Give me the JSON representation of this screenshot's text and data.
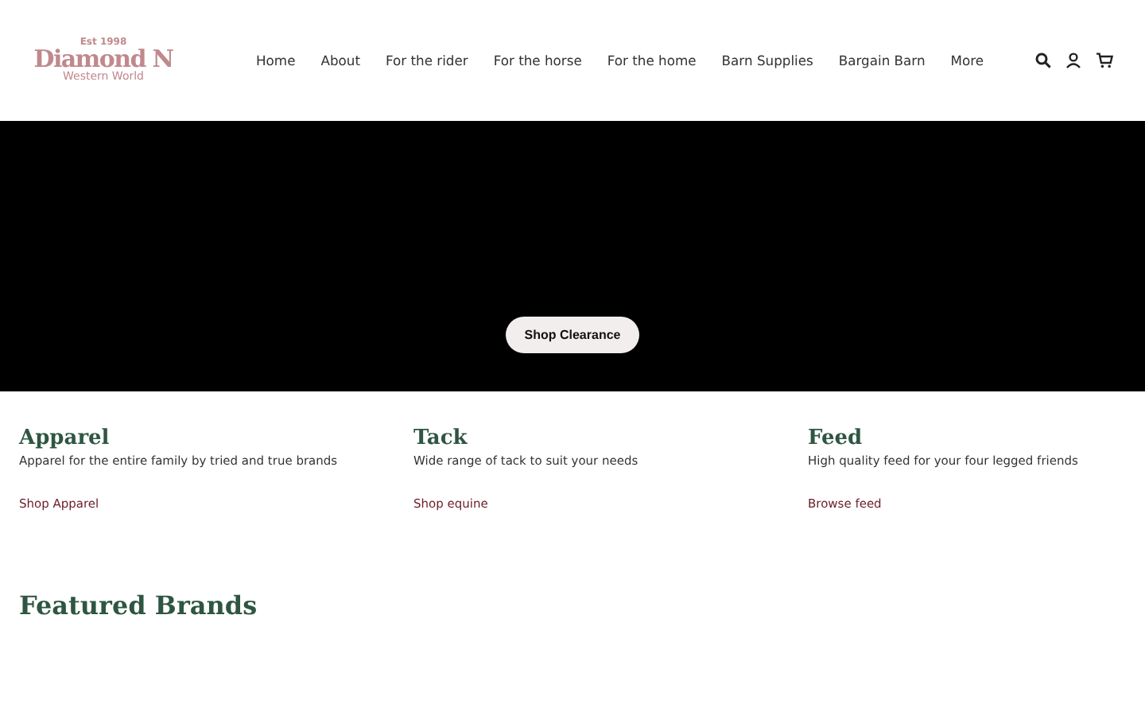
{
  "logo": {
    "est": "Est 1998",
    "name": "Diamond N",
    "sub": "Western World"
  },
  "nav": [
    {
      "label": "Home"
    },
    {
      "label": "About"
    },
    {
      "label": "For the rider"
    },
    {
      "label": "For the horse"
    },
    {
      "label": "For the home"
    },
    {
      "label": "Barn Supplies"
    },
    {
      "label": "Bargain Barn"
    },
    {
      "label": "More"
    }
  ],
  "hero": {
    "button": "Shop Clearance"
  },
  "categories": [
    {
      "title": "Apparel",
      "text": "Apparel for the entire family by tried and true brands",
      "link": "Shop Apparel"
    },
    {
      "title": "Tack",
      "text": "Wide range of tack to suit your needs",
      "link": "Shop equine"
    },
    {
      "title": "Feed",
      "text": "High quality feed for your four legged friends",
      "link": "Browse feed"
    }
  ],
  "featured": {
    "title": "Featured Brands"
  }
}
